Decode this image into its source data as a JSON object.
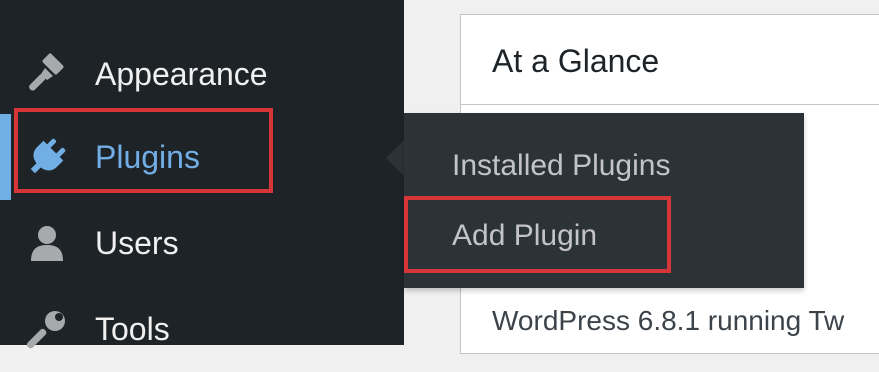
{
  "sidebar": {
    "items": [
      {
        "label": "Appearance",
        "icon": "paintbrush-icon"
      },
      {
        "label": "Plugins",
        "icon": "plugin-icon",
        "current": true
      },
      {
        "label": "Users",
        "icon": "user-icon"
      },
      {
        "label": "Tools",
        "icon": "wrench-icon"
      }
    ]
  },
  "flyout": {
    "items": [
      {
        "label": "Installed Plugins"
      },
      {
        "label": "Add Plugin"
      }
    ]
  },
  "dashboard": {
    "widget_title": "At a Glance",
    "version_text": "WordPress 6.8.1 running Tw"
  },
  "colors": {
    "sidebar_bg": "#1d2327",
    "submenu_bg": "#2c3338",
    "accent": "#72aee6",
    "highlight": "#d63638",
    "content_bg": "#f0f0f1"
  }
}
